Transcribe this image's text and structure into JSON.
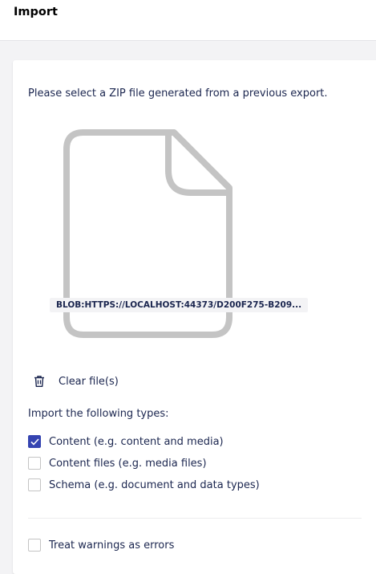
{
  "header": {
    "title": "Import"
  },
  "import_panel": {
    "instruction": "Please select a ZIP file generated from a previous export.",
    "selected_file": {
      "name": "BLOB:HTTPS://LOCALHOST:44373/D200F275-B209...",
      "icon": "file-icon"
    },
    "clear_files": {
      "label": "Clear file(s)",
      "icon": "trash-icon"
    },
    "types_heading": "Import the following types:",
    "types": [
      {
        "label": "Content (e.g. content and media)",
        "checked": true
      },
      {
        "label": "Content files (e.g. media files)",
        "checked": false
      },
      {
        "label": "Schema (e.g. document and data types)",
        "checked": false
      }
    ],
    "treat_warnings": {
      "label": "Treat warnings as errors",
      "checked": false
    }
  },
  "colors": {
    "accent": "#3544b1",
    "text": "#1b264f",
    "file_icon": "#c4c4c4",
    "background": "#f3f3f5"
  }
}
